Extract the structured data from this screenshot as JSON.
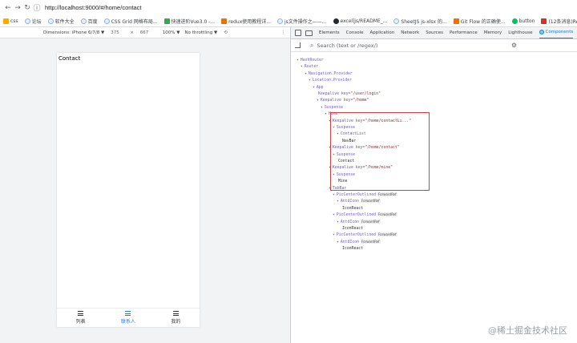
{
  "browser": {
    "url": "http://localhost:9000/#/home/contact",
    "bookmarks": [
      {
        "label": "css",
        "icon": "folder"
      },
      {
        "label": "论坛",
        "icon": "globe"
      },
      {
        "label": "软件大全",
        "icon": "globe"
      },
      {
        "label": "百度",
        "icon": "globe"
      },
      {
        "label": "CSS Grid 网格布局...",
        "icon": "globe"
      },
      {
        "label": "快速进阶Vue3.0 -...",
        "icon": "green"
      },
      {
        "label": "redux使用教程详...",
        "icon": "orange"
      },
      {
        "label": "js文件操作之——...",
        "icon": "globe"
      },
      {
        "label": "excel|js/README_...",
        "icon": "dark"
      },
      {
        "label": "SheetJS js-xlsx 的...",
        "icon": "globe"
      },
      {
        "label": "Git Flow 的正确使...",
        "icon": "orange"
      },
      {
        "label": "button",
        "icon": "chat"
      },
      {
        "label": "(12条消息)React16...",
        "icon": "red"
      }
    ]
  },
  "device_toolbar": {
    "dimensions_label": "Dimensions: iPhone 6/7/8 ▼",
    "width": "375",
    "times": "×",
    "height": "667",
    "zoom": "100% ▼",
    "throttle": "No throttling ▼",
    "rotate": "⟲",
    "more": "⋮"
  },
  "phone": {
    "page_title": "Contact",
    "tabs": [
      {
        "label": "列表",
        "active": false
      },
      {
        "label": "联系人",
        "active": true
      },
      {
        "label": "我的",
        "active": false
      }
    ]
  },
  "devtools": {
    "tabs": [
      "Elements",
      "Console",
      "Application",
      "Network",
      "Sources",
      "Performance",
      "Memory",
      "Lighthouse",
      "Components"
    ],
    "active_tab": "Components",
    "search_placeholder": "Search (text or /regex/)",
    "tree": [
      {
        "indent": 0,
        "arrow": "▾",
        "tag": "HashRouter",
        "badge": ""
      },
      {
        "indent": 1,
        "arrow": "▾",
        "tag": "Router",
        "badge": ""
      },
      {
        "indent": 2,
        "arrow": "▾",
        "tag": "Navigation.Provider",
        "badge": ""
      },
      {
        "indent": 3,
        "arrow": "▾",
        "tag": "Location.Provider",
        "badge": ""
      },
      {
        "indent": 4,
        "arrow": "▾",
        "tag": "App",
        "badge": ""
      },
      {
        "indent": 5,
        "arrow": "",
        "tag": "Keepalive",
        "key": "key=",
        "val": "\"/user/login\"",
        "badge": ""
      },
      {
        "indent": 5,
        "arrow": "▾",
        "tag": "Keepalive",
        "key": "key=",
        "val": "\"/home\"",
        "badge": ""
      },
      {
        "indent": 6,
        "arrow": "▾",
        "tag": "Suspense",
        "badge": ""
      },
      {
        "indent": 7,
        "arrow": "▾",
        "tag": "Home",
        "badge": ""
      },
      {
        "indent": 8,
        "arrow": "▾",
        "tag": "Keepalive",
        "key": "key=",
        "val": "\"/home/contactLi...\"",
        "badge": ""
      },
      {
        "indent": 9,
        "arrow": "▾",
        "tag": "Suspense",
        "badge": ""
      },
      {
        "indent": 10,
        "arrow": "▾",
        "tag": "ContactList",
        "badge": ""
      },
      {
        "indent": 11,
        "arrow": "",
        "tag": "NavBar",
        "badge": "",
        "leaf": true
      },
      {
        "indent": 8,
        "arrow": "▾",
        "tag": "Keepalive",
        "key": "key=",
        "val": "\"/home/contact\"",
        "badge": ""
      },
      {
        "indent": 9,
        "arrow": "▾",
        "tag": "Suspense",
        "badge": ""
      },
      {
        "indent": 10,
        "arrow": "",
        "tag": "Contact",
        "badge": "",
        "leaf": true
      },
      {
        "indent": 8,
        "arrow": "▾",
        "tag": "Keepalive",
        "key": "key=",
        "val": "\"/home/mine\"",
        "badge": ""
      },
      {
        "indent": 9,
        "arrow": "▾",
        "tag": "Suspense",
        "badge": ""
      },
      {
        "indent": 10,
        "arrow": "",
        "tag": "Mine",
        "badge": "",
        "leaf": true
      },
      {
        "indent": 8,
        "arrow": "▾",
        "tag": "TabBar",
        "badge": ""
      },
      {
        "indent": 9,
        "arrow": "▾",
        "tag": "PicCenterOutlined",
        "badge": "ForwardRef"
      },
      {
        "indent": 10,
        "arrow": "▾",
        "tag": "AntdIcon",
        "badge": "ForwardRef"
      },
      {
        "indent": 11,
        "arrow": "",
        "tag": "IconReact",
        "badge": "",
        "leaf": true
      },
      {
        "indent": 9,
        "arrow": "▾",
        "tag": "PicCenterOutlined",
        "badge": "ForwardRef"
      },
      {
        "indent": 10,
        "arrow": "▾",
        "tag": "AntdIcon",
        "badge": "ForwardRef"
      },
      {
        "indent": 11,
        "arrow": "",
        "tag": "IconReact",
        "badge": "",
        "leaf": true
      },
      {
        "indent": 9,
        "arrow": "▾",
        "tag": "PicCenterOutlined",
        "badge": "ForwardRef"
      },
      {
        "indent": 10,
        "arrow": "▾",
        "tag": "AntdIcon",
        "badge": "ForwardRef"
      },
      {
        "indent": 11,
        "arrow": "",
        "tag": "IconReact",
        "badge": "",
        "leaf": true
      }
    ]
  },
  "watermark": "@稀土掘金技术社区",
  "colors": {
    "accent": "#1a73e8",
    "active_tab": "#1677ff",
    "highlight_box": "#e53935",
    "component_name": "#6e59d9",
    "prop_value": "#8c2d2d"
  }
}
